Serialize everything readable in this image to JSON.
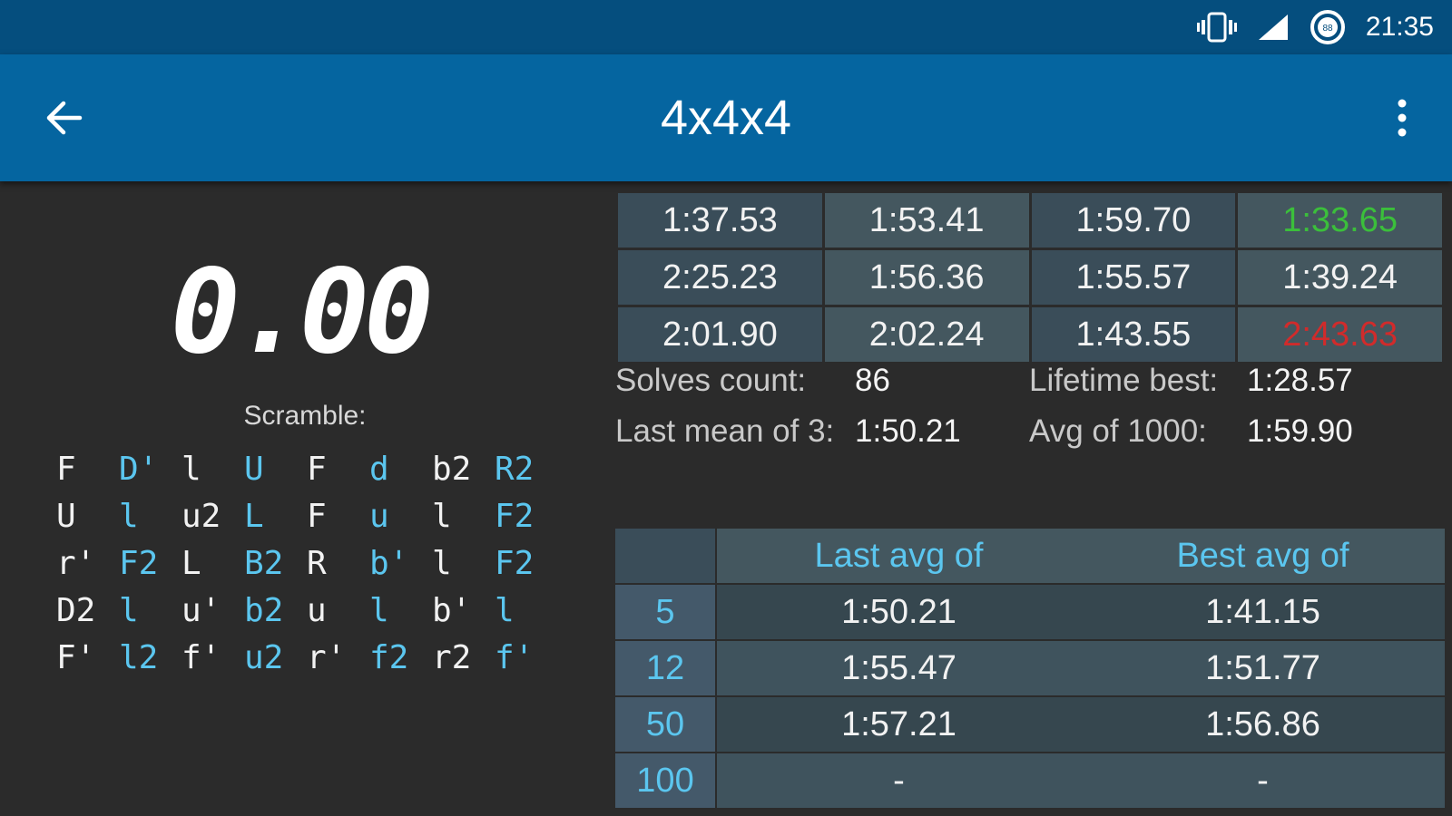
{
  "status_bar": {
    "time": "21:35",
    "icons": [
      "vibrate-icon",
      "signal-icon",
      "battery-saver-icon"
    ]
  },
  "app_bar": {
    "title": "4x4x4",
    "back_icon": "arrow-left-icon",
    "menu_icon": "more-vert-icon"
  },
  "timer": {
    "display": "0.00"
  },
  "scramble": {
    "label": "Scramble:",
    "rows": [
      [
        [
          "F",
          "w"
        ],
        [
          "D'",
          "b"
        ],
        [
          "l",
          "w"
        ],
        [
          "U",
          "b"
        ],
        [
          "F",
          "w"
        ],
        [
          "d",
          "b"
        ],
        [
          "b2",
          "w"
        ],
        [
          "R2",
          "b"
        ]
      ],
      [
        [
          "U",
          "w"
        ],
        [
          "l",
          "b"
        ],
        [
          "u2",
          "w"
        ],
        [
          "L",
          "b"
        ],
        [
          "F",
          "w"
        ],
        [
          "u",
          "b"
        ],
        [
          "l",
          "w"
        ],
        [
          "F2",
          "b"
        ]
      ],
      [
        [
          "r'",
          "w"
        ],
        [
          "F2",
          "b"
        ],
        [
          "L",
          "w"
        ],
        [
          "B2",
          "b"
        ],
        [
          "R",
          "w"
        ],
        [
          "b'",
          "b"
        ],
        [
          "l",
          "w"
        ],
        [
          "F2",
          "b"
        ]
      ],
      [
        [
          "D2",
          "w"
        ],
        [
          "l",
          "b"
        ],
        [
          "u'",
          "w"
        ],
        [
          "b2",
          "b"
        ],
        [
          "u",
          "w"
        ],
        [
          "l",
          "b"
        ],
        [
          "b'",
          "w"
        ],
        [
          "l",
          "b"
        ]
      ],
      [
        [
          "F'",
          "w"
        ],
        [
          "l2",
          "b"
        ],
        [
          "f'",
          "w"
        ],
        [
          "u2",
          "b"
        ],
        [
          "r'",
          "w"
        ],
        [
          "f2",
          "b"
        ],
        [
          "r2",
          "w"
        ],
        [
          "f'",
          "b"
        ]
      ]
    ]
  },
  "recent_times": [
    [
      "1:37.53",
      "1:53.41",
      "1:59.70",
      "1:33.65"
    ],
    [
      "2:25.23",
      "1:56.36",
      "1:55.57",
      "1:39.24"
    ],
    [
      "2:01.90",
      "2:02.24",
      "1:43.55",
      "2:43.63"
    ]
  ],
  "highlights": {
    "best": "1:33.65",
    "worst": "2:43.63",
    "best_color": "#3bbf3b",
    "worst_color": "#d12b2b"
  },
  "stats": {
    "solves_count_label": "Solves count:",
    "solves_count": "86",
    "lifetime_best_label": "Lifetime best:",
    "lifetime_best": "1:28.57",
    "last_mean_label": "Last mean of 3:",
    "last_mean": "1:50.21",
    "avg_1000_label": "Avg of 1000:",
    "avg_1000": "1:59.90"
  },
  "averages": {
    "header_last": "Last avg of",
    "header_best": "Best avg of",
    "rows": [
      {
        "n": "5",
        "last": "1:50.21",
        "best": "1:41.15"
      },
      {
        "n": "12",
        "last": "1:55.47",
        "best": "1:51.77"
      },
      {
        "n": "50",
        "last": "1:57.21",
        "best": "1:56.86"
      },
      {
        "n": "100",
        "last": "-",
        "best": "-"
      }
    ]
  },
  "colors": {
    "status_bar": "#054e7e",
    "app_bar": "#0565a0",
    "background": "#2b2b2b",
    "accent": "#5bc6ef"
  }
}
